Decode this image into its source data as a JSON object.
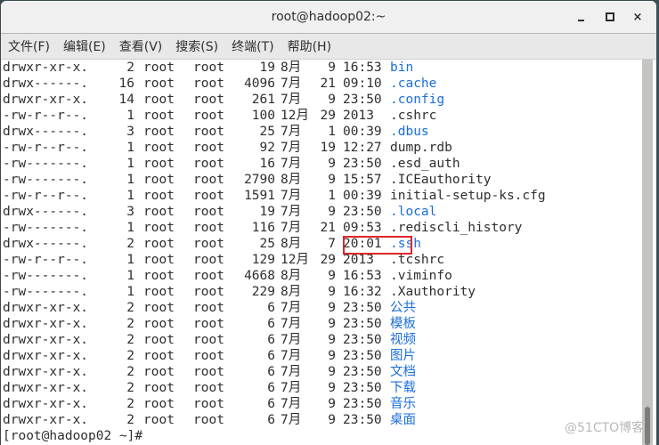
{
  "window": {
    "title": "root@hadoop02:~",
    "controls": {
      "minimize": "minimize",
      "maximize": "maximize",
      "close": "×"
    }
  },
  "menubar": {
    "items": [
      "文件(F)",
      "编辑(E)",
      "查看(V)",
      "搜索(S)",
      "终端(T)",
      "帮助(H)"
    ]
  },
  "terminal": {
    "listing": [
      {
        "perm": "drwxr-xr-x.",
        "links": "2",
        "owner": "root",
        "group": "root",
        "size": "19",
        "month": "8月",
        "day": "9",
        "time": "16:53",
        "name": "bin",
        "is_dir": true
      },
      {
        "perm": "drwx------.",
        "links": "16",
        "owner": "root",
        "group": "root",
        "size": "4096",
        "month": "7月",
        "day": "21",
        "time": "09:10",
        "name": ".cache",
        "is_dir": true
      },
      {
        "perm": "drwxr-xr-x.",
        "links": "14",
        "owner": "root",
        "group": "root",
        "size": "261",
        "month": "7月",
        "day": "9",
        "time": "23:50",
        "name": ".config",
        "is_dir": true
      },
      {
        "perm": "-rw-r--r--.",
        "links": "1",
        "owner": "root",
        "group": "root",
        "size": "100",
        "month": "12月",
        "day": "29",
        "time": "2013",
        "name": ".cshrc",
        "is_dir": false
      },
      {
        "perm": "drwx------.",
        "links": "3",
        "owner": "root",
        "group": "root",
        "size": "25",
        "month": "7月",
        "day": "1",
        "time": "00:39",
        "name": ".dbus",
        "is_dir": true
      },
      {
        "perm": "-rw-r--r--.",
        "links": "1",
        "owner": "root",
        "group": "root",
        "size": "92",
        "month": "7月",
        "day": "19",
        "time": "12:27",
        "name": "dump.rdb",
        "is_dir": false
      },
      {
        "perm": "-rw-------.",
        "links": "1",
        "owner": "root",
        "group": "root",
        "size": "16",
        "month": "7月",
        "day": "9",
        "time": "23:50",
        "name": ".esd_auth",
        "is_dir": false
      },
      {
        "perm": "-rw-------.",
        "links": "1",
        "owner": "root",
        "group": "root",
        "size": "2790",
        "month": "8月",
        "day": "9",
        "time": "15:57",
        "name": ".ICEauthority",
        "is_dir": false
      },
      {
        "perm": "-rw-r--r--.",
        "links": "1",
        "owner": "root",
        "group": "root",
        "size": "1591",
        "month": "7月",
        "day": "1",
        "time": "00:39",
        "name": "initial-setup-ks.cfg",
        "is_dir": false
      },
      {
        "perm": "drwx------.",
        "links": "3",
        "owner": "root",
        "group": "root",
        "size": "19",
        "month": "7月",
        "day": "9",
        "time": "23:50",
        "name": ".local",
        "is_dir": true
      },
      {
        "perm": "-rw-------.",
        "links": "1",
        "owner": "root",
        "group": "root",
        "size": "116",
        "month": "7月",
        "day": "21",
        "time": "09:53",
        "name": ".rediscli_history",
        "is_dir": false
      },
      {
        "perm": "drwx------.",
        "links": "2",
        "owner": "root",
        "group": "root",
        "size": "25",
        "month": "8月",
        "day": "7",
        "time": "20:01",
        "name": ".ssh",
        "is_dir": true
      },
      {
        "perm": "-rw-r--r--.",
        "links": "1",
        "owner": "root",
        "group": "root",
        "size": "129",
        "month": "12月",
        "day": "29",
        "time": "2013",
        "name": ".tcshrc",
        "is_dir": false
      },
      {
        "perm": "-rw-------.",
        "links": "1",
        "owner": "root",
        "group": "root",
        "size": "4668",
        "month": "8月",
        "day": "9",
        "time": "16:53",
        "name": ".viminfo",
        "is_dir": false
      },
      {
        "perm": "-rw-------.",
        "links": "1",
        "owner": "root",
        "group": "root",
        "size": "229",
        "month": "8月",
        "day": "9",
        "time": "16:32",
        "name": ".Xauthority",
        "is_dir": false
      },
      {
        "perm": "drwxr-xr-x.",
        "links": "2",
        "owner": "root",
        "group": "root",
        "size": "6",
        "month": "7月",
        "day": "9",
        "time": "23:50",
        "name": "公共",
        "is_dir": true
      },
      {
        "perm": "drwxr-xr-x.",
        "links": "2",
        "owner": "root",
        "group": "root",
        "size": "6",
        "month": "7月",
        "day": "9",
        "time": "23:50",
        "name": "模板",
        "is_dir": true
      },
      {
        "perm": "drwxr-xr-x.",
        "links": "2",
        "owner": "root",
        "group": "root",
        "size": "6",
        "month": "7月",
        "day": "9",
        "time": "23:50",
        "name": "视频",
        "is_dir": true
      },
      {
        "perm": "drwxr-xr-x.",
        "links": "2",
        "owner": "root",
        "group": "root",
        "size": "6",
        "month": "7月",
        "day": "9",
        "time": "23:50",
        "name": "图片",
        "is_dir": true
      },
      {
        "perm": "drwxr-xr-x.",
        "links": "2",
        "owner": "root",
        "group": "root",
        "size": "6",
        "month": "7月",
        "day": "9",
        "time": "23:50",
        "name": "文档",
        "is_dir": true
      },
      {
        "perm": "drwxr-xr-x.",
        "links": "2",
        "owner": "root",
        "group": "root",
        "size": "6",
        "month": "7月",
        "day": "9",
        "time": "23:50",
        "name": "下载",
        "is_dir": true
      },
      {
        "perm": "drwxr-xr-x.",
        "links": "2",
        "owner": "root",
        "group": "root",
        "size": "6",
        "month": "7月",
        "day": "9",
        "time": "23:50",
        "name": "音乐",
        "is_dir": true
      },
      {
        "perm": "drwxr-xr-x.",
        "links": "2",
        "owner": "root",
        "group": "root",
        "size": "6",
        "month": "7月",
        "day": "9",
        "time": "23:50",
        "name": "桌面",
        "is_dir": true
      }
    ],
    "prompt": "[root@hadoop02 ~]# ",
    "highlighted_entry": ".ssh"
  },
  "colors": {
    "directory": "#1a6edb",
    "text": "#2e2e2e",
    "highlight_box": "#e0262a"
  },
  "watermark": "@51CTO博客"
}
